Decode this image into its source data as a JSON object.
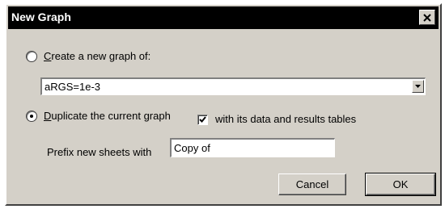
{
  "dialog": {
    "title": "New Graph",
    "close_icon": "close-icon"
  },
  "options": {
    "create_new": {
      "label_accel": "C",
      "label_rest": "reate a new graph of:",
      "selected": false
    },
    "graph_select": {
      "value": "aRGS=1e-3"
    },
    "duplicate": {
      "label_accel": "D",
      "label_rest": "uplicate the current graph",
      "selected": true
    },
    "with_tables": {
      "label": "with its data and results tables",
      "checked": true
    },
    "prefix": {
      "label": "Prefix new sheets with",
      "value": "Copy of"
    }
  },
  "buttons": {
    "cancel": "Cancel",
    "ok": "OK"
  }
}
